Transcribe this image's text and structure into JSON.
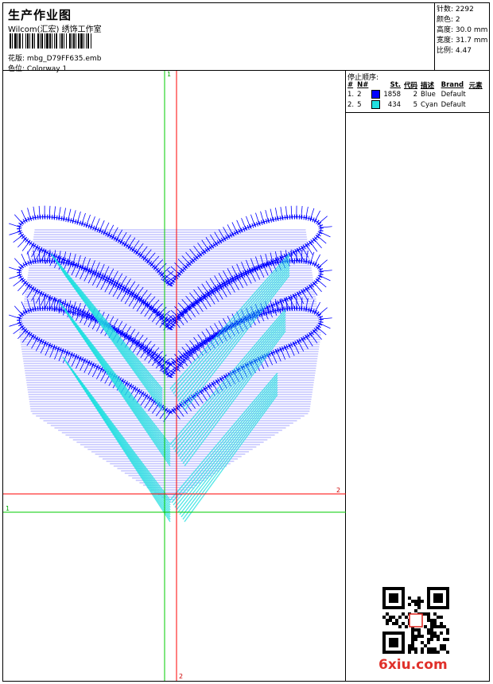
{
  "header": {
    "title": "生产作业图",
    "subtitle": "Wilcom(汇宏) 绣饰工作室",
    "design_label": "花版:",
    "design_file": "mbg_D79FF635.emb",
    "colorway_label": "色位:",
    "colorway": "Colorway 1"
  },
  "stats": [
    {
      "label": "针数:",
      "value": "2292"
    },
    {
      "label": "颜色:",
      "value": "2"
    },
    {
      "label": "高度:",
      "value": "30.0 mm"
    },
    {
      "label": "宽度:",
      "value": "31.7 mm"
    },
    {
      "label": "比例:",
      "value": "4.47"
    }
  ],
  "stops_panel": {
    "title": "停止顺序:",
    "columns": [
      "#",
      "N#",
      "St.",
      "代码",
      "描述",
      "Brand",
      "元素"
    ],
    "rows": [
      {
        "index": "1.",
        "needle": "2",
        "color": "#0000ff",
        "stitches": "1858",
        "code": "2",
        "desc": "Blue",
        "brand": "Default"
      },
      {
        "index": "2.",
        "needle": "5",
        "color": "#22e0e0",
        "stitches": "434",
        "code": "5",
        "desc": "Cyan",
        "brand": "Default"
      }
    ]
  },
  "axes": {
    "green_label": "1",
    "red_label": "2",
    "colors": {
      "green": "#00cc00",
      "red": "#ff0000"
    }
  },
  "design_colors": {
    "blue": "#0000ff",
    "cyan": "#22e0e0"
  },
  "watermark": {
    "text": "6xiu.com",
    "color": "#e0302a"
  }
}
